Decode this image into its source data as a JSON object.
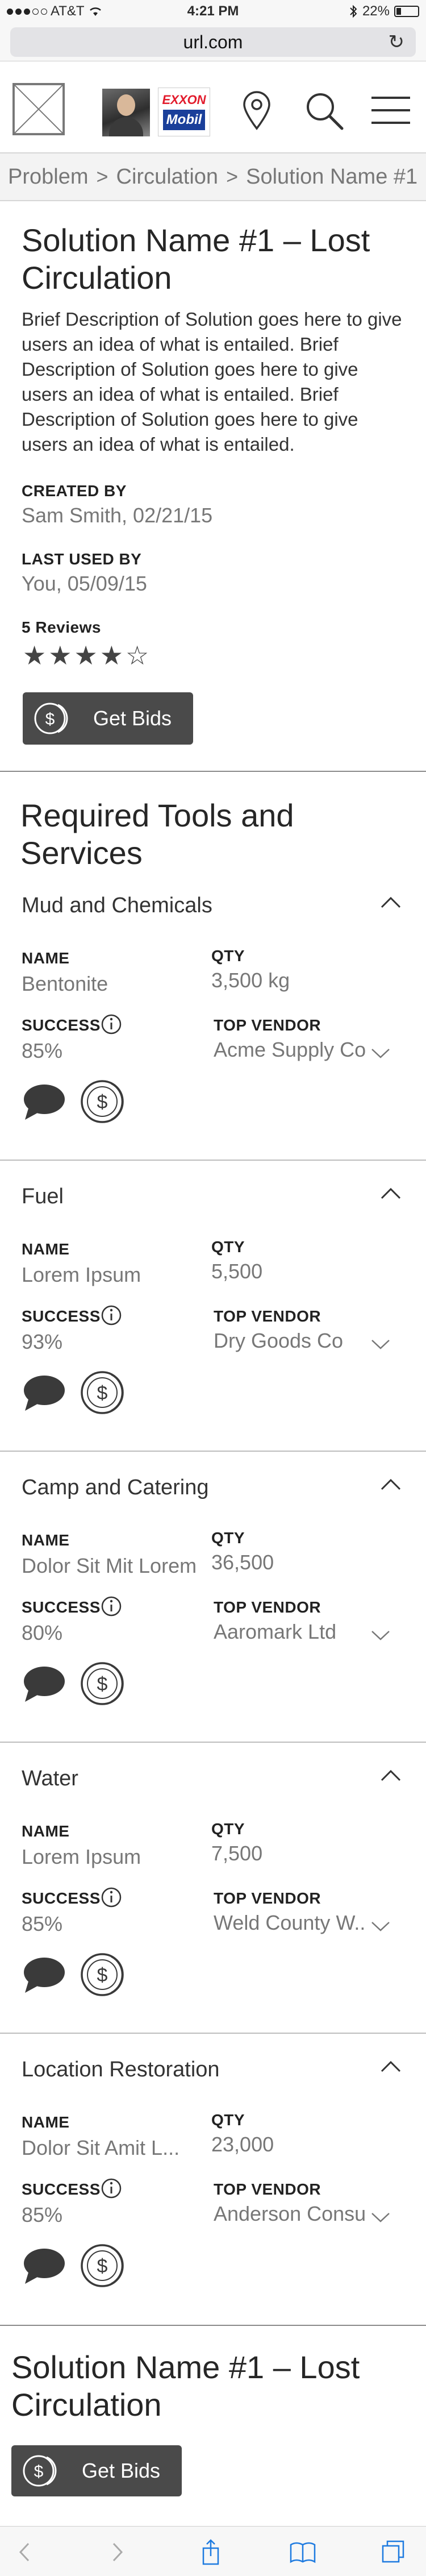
{
  "status_bar": {
    "carrier": "AT&T",
    "time": "4:21 PM",
    "battery": "22%"
  },
  "browser": {
    "url": "url.com"
  },
  "header": {
    "brand_top": "EXXON",
    "brand_bottom": "Mobil"
  },
  "breadcrumb": [
    "Problem",
    "Circulation",
    "Solution Name #1"
  ],
  "solution": {
    "title": "Solution Name #1 – Lost Circulation",
    "description": "Brief Description of Solution goes here to give users an idea of what is entailed. Brief Description of Solution goes here to give users an idea of what is entailed. Brief Description of Solution goes here to give users an idea of what is entailed.",
    "created_by_label": "CREATED BY",
    "created_by_value": "Sam Smith, 02/21/15",
    "last_used_label": "LAST USED BY",
    "last_used_value": "You, 05/09/15",
    "reviews_label": "5 Reviews",
    "rating": 4,
    "rating_max": 5,
    "get_bids_label": "Get Bids"
  },
  "required_section_title": "Required Tools and Services",
  "labels": {
    "name": "NAME",
    "qty": "QTY",
    "success": "SUCCESS",
    "top_vendor": "TOP VENDOR"
  },
  "tools": [
    {
      "title": "Mud and Chemicals",
      "name": "Bentonite",
      "qty": "3,500 kg",
      "success": "85%",
      "vendor": "Acme Supply Co"
    },
    {
      "title": "Fuel",
      "name": "Lorem Ipsum",
      "qty": "5,500",
      "success": "93%",
      "vendor": "Dry Goods Co"
    },
    {
      "title": "Camp and Catering",
      "name": "Dolor Sit Mit Lorem",
      "qty": "36,500",
      "success": "80%",
      "vendor": "Aaromark Ltd"
    },
    {
      "title": "Water",
      "name": "Lorem Ipsum",
      "qty": "7,500",
      "success": "85%",
      "vendor": "Weld County W..."
    },
    {
      "title": "Location Restoration",
      "name": "Dolor Sit Amit L...",
      "qty": "23,000",
      "success": "85%",
      "vendor": "Anderson Consu..."
    }
  ],
  "footer": {
    "title": "Solution Name #1 – Lost Circulation",
    "get_bids_label": "Get Bids"
  },
  "colors": {
    "dark_button": "#4a4a4a",
    "muted_text": "#777777",
    "brand_red": "#e21b2c",
    "brand_blue": "#1a3f9a"
  }
}
